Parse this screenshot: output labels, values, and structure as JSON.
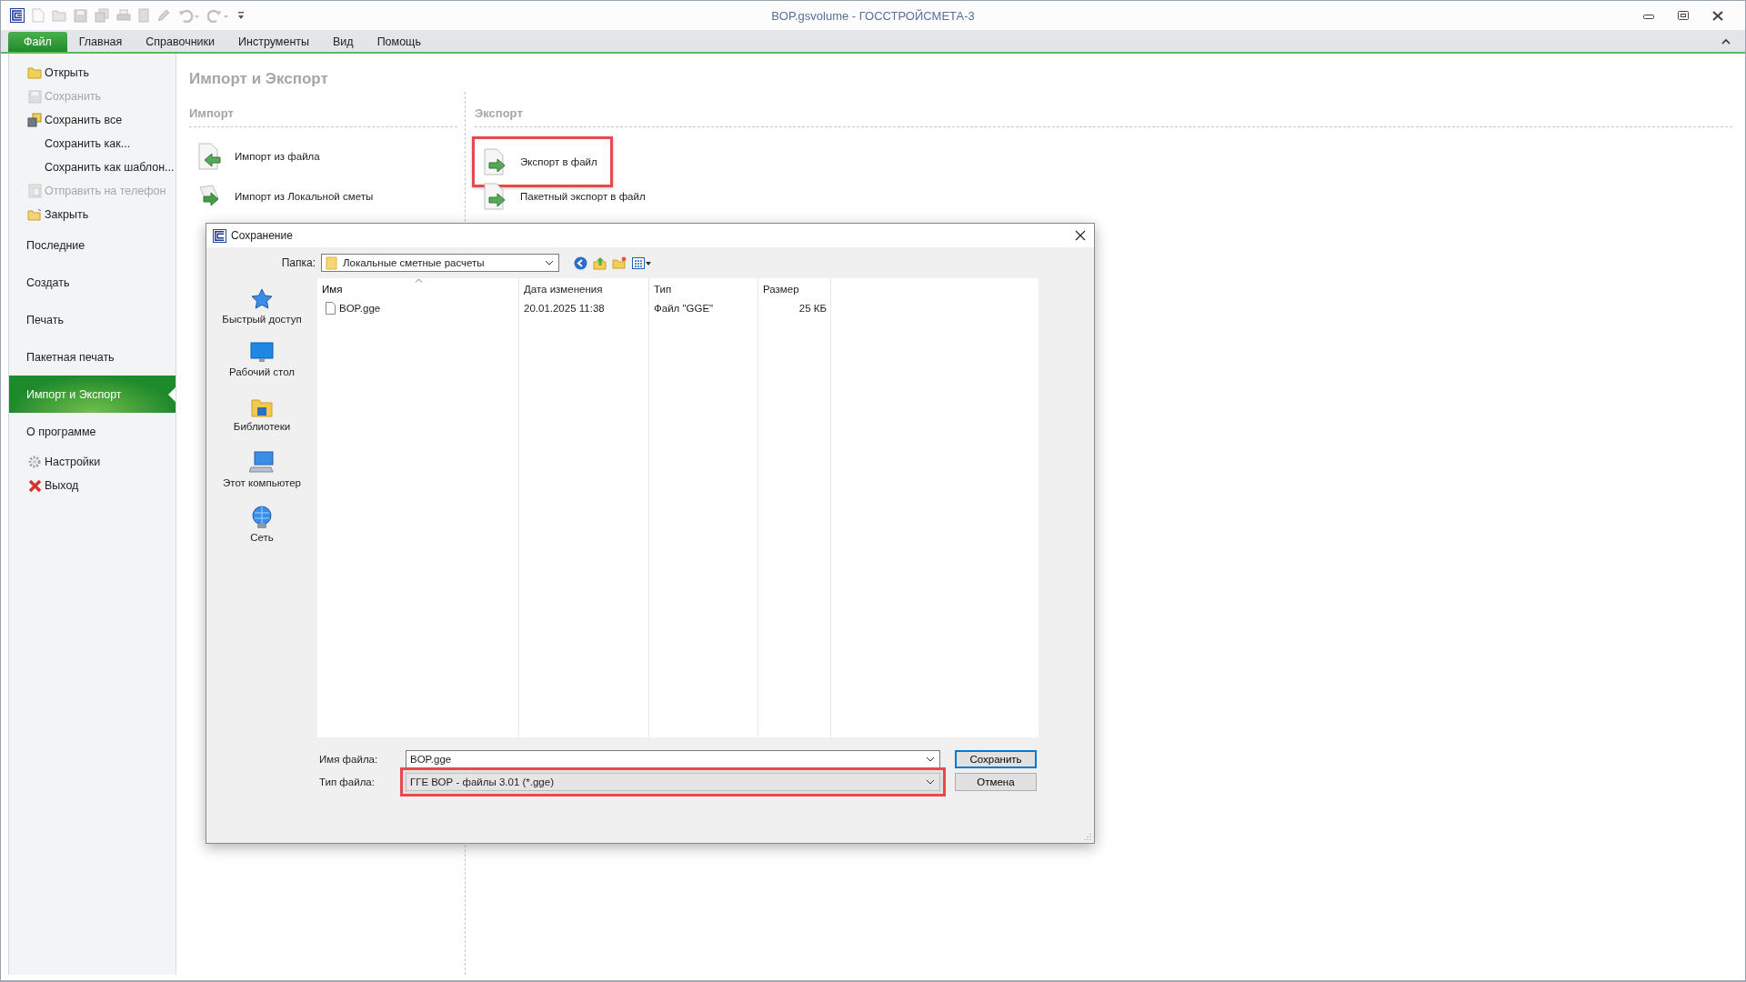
{
  "window": {
    "title": "BOP.gsvolume - ГОССТРОЙСМЕТА-3"
  },
  "ribbon_tabs": [
    {
      "label": "Файл",
      "selected": true
    },
    {
      "label": "Главная",
      "selected": false
    },
    {
      "label": "Справочники",
      "selected": false
    },
    {
      "label": "Инструменты",
      "selected": false
    },
    {
      "label": "Вид",
      "selected": false
    },
    {
      "label": "Помощь",
      "selected": false
    }
  ],
  "sidebar": {
    "items": [
      {
        "kind": "command",
        "label": "Открыть",
        "disabled": false,
        "selected": false
      },
      {
        "kind": "command",
        "label": "Сохранить",
        "disabled": true,
        "selected": false
      },
      {
        "kind": "command",
        "label": "Сохранить все",
        "disabled": false,
        "selected": false
      },
      {
        "kind": "command",
        "label": "Сохранить как...",
        "disabled": false,
        "selected": false
      },
      {
        "kind": "command",
        "label": "Сохранить как шаблон...",
        "disabled": false,
        "selected": false
      },
      {
        "kind": "command",
        "label": "Отправить на телефон",
        "disabled": true,
        "selected": false
      },
      {
        "kind": "command",
        "label": "Закрыть",
        "disabled": false,
        "selected": false
      },
      {
        "kind": "section",
        "label": "Последние",
        "disabled": false,
        "selected": false
      },
      {
        "kind": "section",
        "label": "Создать",
        "disabled": false,
        "selected": false
      },
      {
        "kind": "section",
        "label": "Печать",
        "disabled": false,
        "selected": false
      },
      {
        "kind": "section",
        "label": "Пакетная печать",
        "disabled": false,
        "selected": false
      },
      {
        "kind": "section",
        "label": "Импорт и Экспорт",
        "disabled": false,
        "selected": true
      },
      {
        "kind": "section",
        "label": "О программе",
        "disabled": false,
        "selected": false
      },
      {
        "kind": "command",
        "label": "Настройки",
        "disabled": false,
        "selected": false
      },
      {
        "kind": "command",
        "label": "Выход",
        "disabled": false,
        "selected": false
      }
    ]
  },
  "page": {
    "title": "Импорт и Экспорт",
    "import": {
      "title": "Импорт",
      "items": [
        {
          "label": "Импорт из файла",
          "highlighted": false
        },
        {
          "label": "Импорт из Локальной сметы",
          "highlighted": false
        }
      ]
    },
    "export": {
      "title": "Экспорт",
      "items": [
        {
          "label": "Экспорт в файл",
          "highlighted": true
        },
        {
          "label": "Пакетный экспорт в файл",
          "highlighted": false
        }
      ]
    }
  },
  "dialog": {
    "title": "Сохранение",
    "folder_label": "Папка:",
    "folder": "Локальные сметные расчеты",
    "places": [
      "Быстрый доступ",
      "Рабочий стол",
      "Библиотеки",
      "Этот компьютер",
      "Сеть"
    ],
    "columns": [
      {
        "label": "Имя",
        "sorted": true
      },
      {
        "label": "Дата изменения",
        "sorted": false
      },
      {
        "label": "Тип",
        "sorted": false
      },
      {
        "label": "Размер",
        "sorted": false
      }
    ],
    "files": [
      {
        "name": "BOP.gge",
        "modified": "20.01.2025 11:38",
        "type": "Файл \"GGE\"",
        "size": "25 КБ"
      }
    ],
    "file_name": {
      "label": "Имя файла:",
      "value": "BOP.gge",
      "highlighted": false
    },
    "file_type": {
      "label": "Тип файла:",
      "value": "ГГЕ ВОР - файлы 3.01 (*.gge)",
      "highlighted": true
    },
    "buttons": [
      {
        "label": "Сохранить",
        "kind": "primary"
      },
      {
        "label": "Отмена",
        "kind": "secondary"
      }
    ]
  }
}
